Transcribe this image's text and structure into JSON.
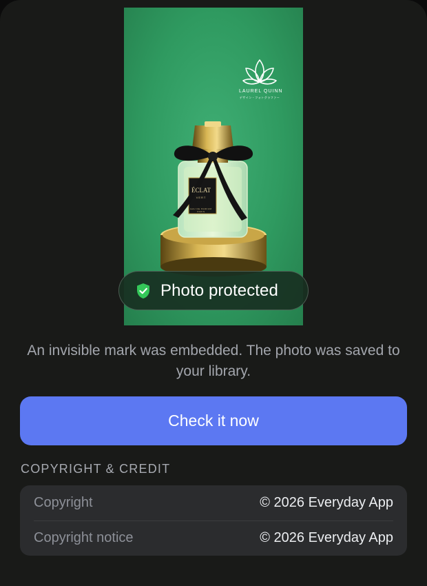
{
  "photo": {
    "brand_name": "LAUREL QUINN",
    "brand_sub": "デザイン・フォトグラファー",
    "label_name": "ÉCLAT",
    "label_sub": "VERT",
    "label_edp": "EAU DE PARFUM PARIS"
  },
  "status": {
    "badge_text": "Photo protected"
  },
  "description": "An invisible mark was embedded. The photo was saved to your library.",
  "primary_button": {
    "label": "Check it now"
  },
  "copyright_section": {
    "header": "COPYRIGHT & CREDIT",
    "rows": [
      {
        "label": "Copyright",
        "value": "© 2026 Everyday App"
      },
      {
        "label": "Copyright notice",
        "value": "© 2026 Everyday App"
      }
    ]
  },
  "colors": {
    "background": "#191a18",
    "accent": "#5c78f2",
    "photo_green": "#2f9a60",
    "shield_green": "#34c759"
  }
}
